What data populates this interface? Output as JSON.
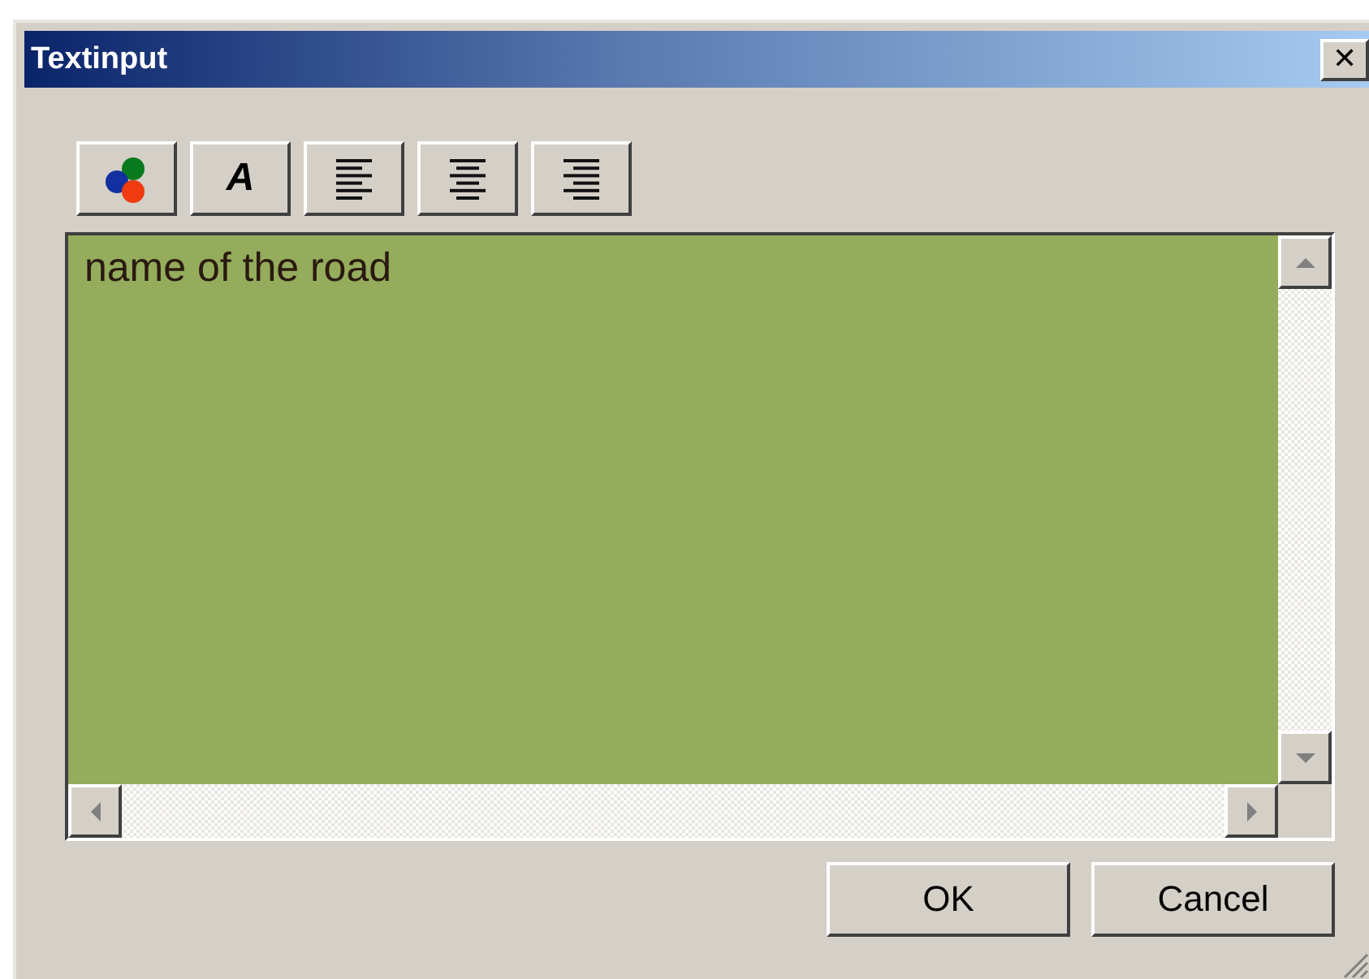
{
  "window": {
    "title": "Textinput",
    "close": "✕"
  },
  "toolbar": [
    {
      "kind": "color"
    },
    {
      "kind": "font",
      "label": "A"
    },
    {
      "kind": "align-left"
    },
    {
      "kind": "align-center"
    },
    {
      "kind": "align-right"
    }
  ],
  "text_area": {
    "value": "name of the road"
  },
  "buttons": [
    "OK",
    "Cancel"
  ]
}
